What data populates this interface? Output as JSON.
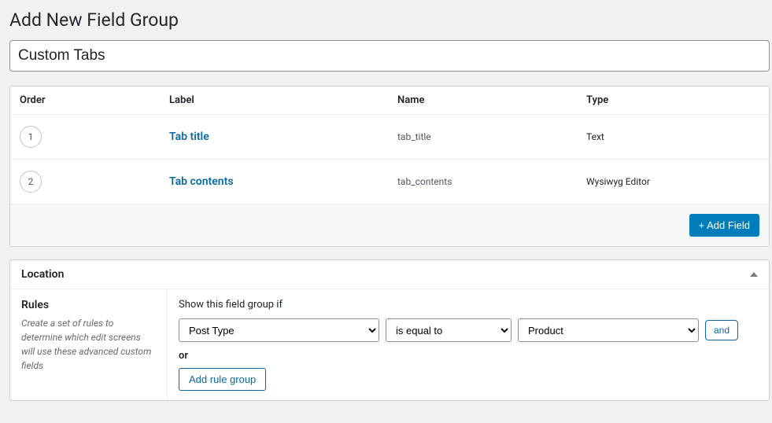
{
  "page": {
    "title": "Add New Field Group"
  },
  "group": {
    "title_value": "Custom Tabs"
  },
  "fields_table": {
    "columns": {
      "order": "Order",
      "label": "Label",
      "name": "Name",
      "type": "Type"
    },
    "rows": [
      {
        "order": "1",
        "label": "Tab title",
        "name": "tab_title",
        "type": "Text"
      },
      {
        "order": "2",
        "label": "Tab contents",
        "name": "tab_contents",
        "type": "Wysiwyg Editor"
      }
    ],
    "add_field_label": "+ Add Field"
  },
  "location": {
    "header": "Location",
    "rules_heading": "Rules",
    "rules_desc": "Create a set of rules to determine which edit screens will use these advanced custom fields",
    "prompt": "Show this field group if",
    "rule": {
      "param": "Post Type",
      "operator": "is equal to",
      "value": "Product",
      "and_label": "and"
    },
    "or_label": "or",
    "add_rule_group_label": "Add rule group"
  }
}
